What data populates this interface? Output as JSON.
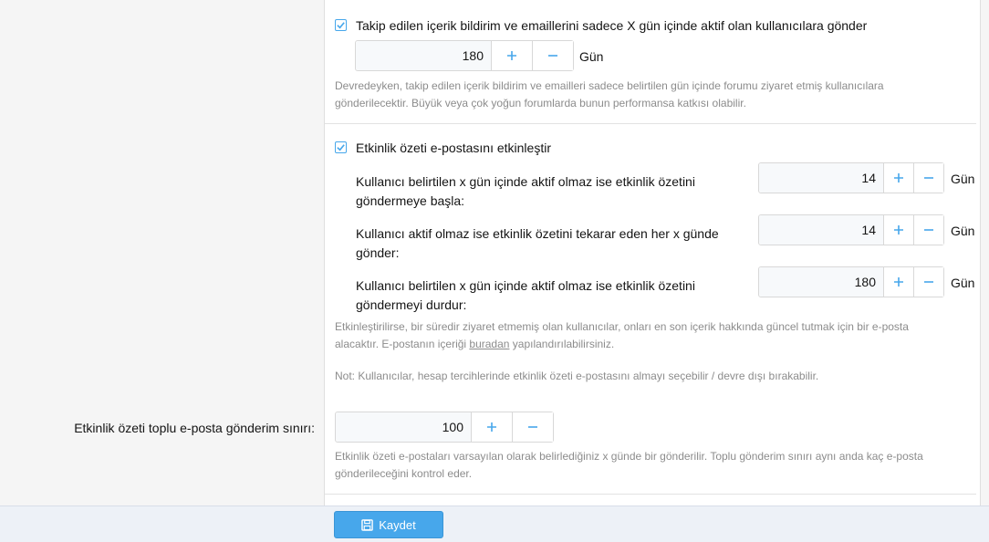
{
  "section1": {
    "checkbox_label": "Takip edilen içerik bildirim ve emaillerini sadece X gün içinde aktif olan kullanıcılara gönder",
    "checked": true,
    "spinner_value": "180",
    "unit": "Gün",
    "hint_line1": "Devredeyken, takip edilen içerik bildirim ve emailleri sadece belirtilen gün içinde forumu ziyaret etmiş kullanıcılara",
    "hint_line2": "gönderilecektir. Büyük veya çok yoğun forumlarda bunun performansa katkısı olabilir."
  },
  "section2": {
    "checkbox_label": "Etkinlik özeti e-postasını etkinleştir",
    "checked": true,
    "rows": [
      {
        "label_line1": "Kullanıcı belirtilen x gün içinde aktif olmaz ise etkinlik özetini",
        "label_line2": "göndermeye başla:",
        "value": "14",
        "unit": "Gün"
      },
      {
        "label_line1": "Kullanıcı aktif olmaz ise etkinlik özetini tekarar eden her x günde",
        "label_line2": "gönder:",
        "value": "14",
        "unit": "Gün"
      },
      {
        "label_line1": "Kullanıcı belirtilen x gün içinde aktif olmaz ise etkinlik özetini",
        "label_line2": "göndermeyi durdur:",
        "value": "180",
        "unit": "Gün"
      }
    ],
    "hint_line1": "Etkinleştirilirse, bir süredir ziyaret etmemiş olan kullanıcılar, onları en son içerik hakkında güncel tutmak için bir e-posta",
    "hint_line2_prefix": "alacaktır. E-postanın içeriği ",
    "hint_link": "buradan",
    "hint_line2_suffix": " yapılandırılabilirsiniz.",
    "note": "Not: Kullanıcılar, hesap tercihlerinde etkinlik özeti e-postasını almayı seçebilir / devre dışı bırakabilir."
  },
  "section3": {
    "row_label": "Etkinlik özeti toplu e-posta gönderim sınırı:",
    "spinner_value": "100",
    "hint_line1": "Etkinlik özeti e-postaları varsayılan olarak belirlediğiniz x günde bir gönderilir. Toplu gönderim sınırı aynı anda kaç e-posta",
    "hint_line2": "gönderileceğini kontrol eder."
  },
  "footer": {
    "save_label": "Kaydet"
  },
  "icons": {
    "check": "check-icon",
    "plus": "plus-icon",
    "minus": "minus-icon",
    "save": "save-icon"
  },
  "colors": {
    "accent": "#47a7eb",
    "hint_text": "#8c8c8c",
    "sidebar_bg": "#f5f5f5",
    "footer_bg": "#edf1f7"
  }
}
